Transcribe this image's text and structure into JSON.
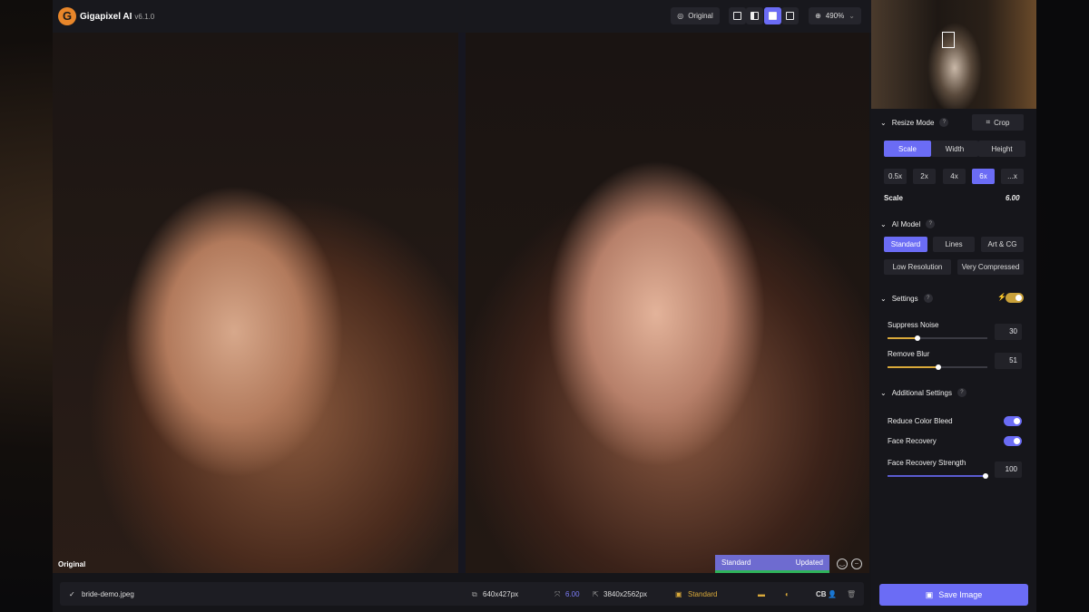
{
  "app": {
    "title": "Gigapixel AI",
    "version": "v6.1.0",
    "logo": "G"
  },
  "toolbar": {
    "original_label": "Original",
    "zoom": "490%"
  },
  "canvas": {
    "original_label": "Original",
    "status_model": "Standard",
    "status_state": "Updated"
  },
  "bottombar": {
    "filename": "bride-demo.jpeg",
    "input_size": "640x427px",
    "scale": "6.00",
    "output_size": "3840x2562px",
    "model": "Standard",
    "cb": "CB"
  },
  "panel": {
    "resize_mode": "Resize Mode",
    "crop": "Crop",
    "modes": [
      "Scale",
      "Width",
      "Height"
    ],
    "scales": [
      "0.5x",
      "2x",
      "4x",
      "6x",
      "...x"
    ],
    "scale_label": "Scale",
    "scale_value": "6.00",
    "ai_model": "AI Model",
    "models": [
      "Standard",
      "Lines",
      "Art & CG",
      "Low Resolution",
      "Very Compressed"
    ],
    "settings": "Settings",
    "suppress_noise": "Suppress Noise",
    "suppress_noise_value": "30",
    "remove_blur": "Remove Blur",
    "remove_blur_value": "51",
    "additional": "Additional Settings",
    "reduce_color_bleed": "Reduce Color Bleed",
    "face_recovery": "Face Recovery",
    "face_strength": "Face Recovery Strength",
    "face_strength_value": "100",
    "save": "Save Image",
    "help": "?"
  },
  "colors": {
    "accent": "#6b6cf5",
    "gold": "#d9a93a",
    "green": "#2fb35a"
  }
}
